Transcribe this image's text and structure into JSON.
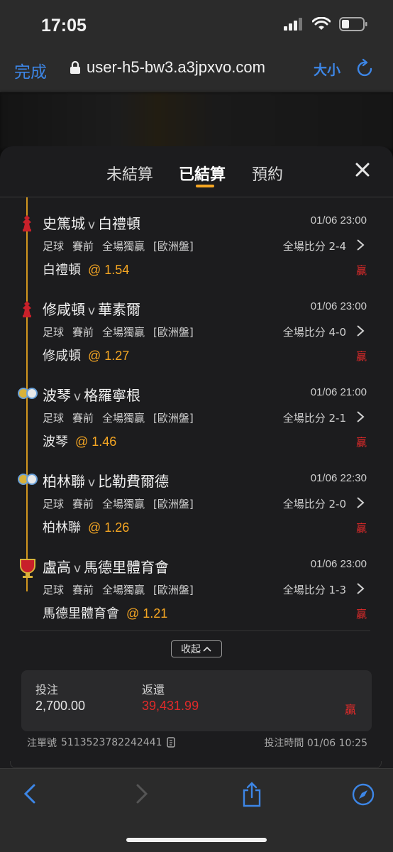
{
  "status": {
    "time": "17:05"
  },
  "browser": {
    "done_label": "完成",
    "url": "user-h5-bw3.a3jpxvo.com",
    "text_size_label": "大小"
  },
  "tabs": [
    {
      "label": "未結算"
    },
    {
      "label": "已結算"
    },
    {
      "label": "預約"
    }
  ],
  "bets": [
    {
      "icon": "team-crest-icon",
      "home": "史篤城",
      "vs": "v",
      "away": "白禮頓",
      "datetime": "01/06 23:00",
      "sport": "足球",
      "stage": "賽前",
      "market": "全場獨贏",
      "odds_type": "[歐洲盤]",
      "score_label": "全場比分 2-4",
      "pick": "白禮頓",
      "odds": "@ 1.54",
      "result": "贏"
    },
    {
      "icon": "team-crest-icon",
      "home": "修咸頓",
      "vs": "v",
      "away": "華素爾",
      "datetime": "01/06 23:00",
      "sport": "足球",
      "stage": "賽前",
      "market": "全場獨贏",
      "odds_type": "[歐洲盤]",
      "score_label": "全場比分 4-0",
      "pick": "修咸頓",
      "odds": "@ 1.27",
      "result": "贏"
    },
    {
      "icon": "league-ball-icon",
      "home": "波琴",
      "vs": "v",
      "away": "格羅寧根",
      "datetime": "01/06 21:00",
      "sport": "足球",
      "stage": "賽前",
      "market": "全場獨贏",
      "odds_type": "[歐洲盤]",
      "score_label": "全場比分 2-1",
      "pick": "波琴",
      "odds": "@ 1.46",
      "result": "贏"
    },
    {
      "icon": "league-ball-icon",
      "home": "柏林聯",
      "vs": "v",
      "away": "比勒費爾德",
      "datetime": "01/06 22:30",
      "sport": "足球",
      "stage": "賽前",
      "market": "全場獨贏",
      "odds_type": "[歐洲盤]",
      "score_label": "全場比分 2-0",
      "pick": "柏林聯",
      "odds": "@ 1.26",
      "result": "贏"
    },
    {
      "icon": "cup-trophy-icon",
      "home": "盧高",
      "vs": "v",
      "away": "馬德里體育會",
      "datetime": "01/06 23:00",
      "sport": "足球",
      "stage": "賽前",
      "market": "全場獨贏",
      "odds_type": "[歐洲盤]",
      "score_label": "全場比分 1-3",
      "pick": "馬德里體育會",
      "odds": "@ 1.21",
      "result": "贏"
    }
  ],
  "collapse_label": "收起",
  "summary": {
    "stake_label": "投注",
    "stake": "2,700.00",
    "return_label": "返還",
    "return": "39,431.99",
    "result": "贏"
  },
  "footer": {
    "order_label": "注單號",
    "order_no": "5113523782242441",
    "time_label": "投注時間",
    "time": "01/06 10:25"
  },
  "colors": {
    "accent": "#f5a623",
    "win": "#e02a2a",
    "link": "#3d86e6"
  }
}
